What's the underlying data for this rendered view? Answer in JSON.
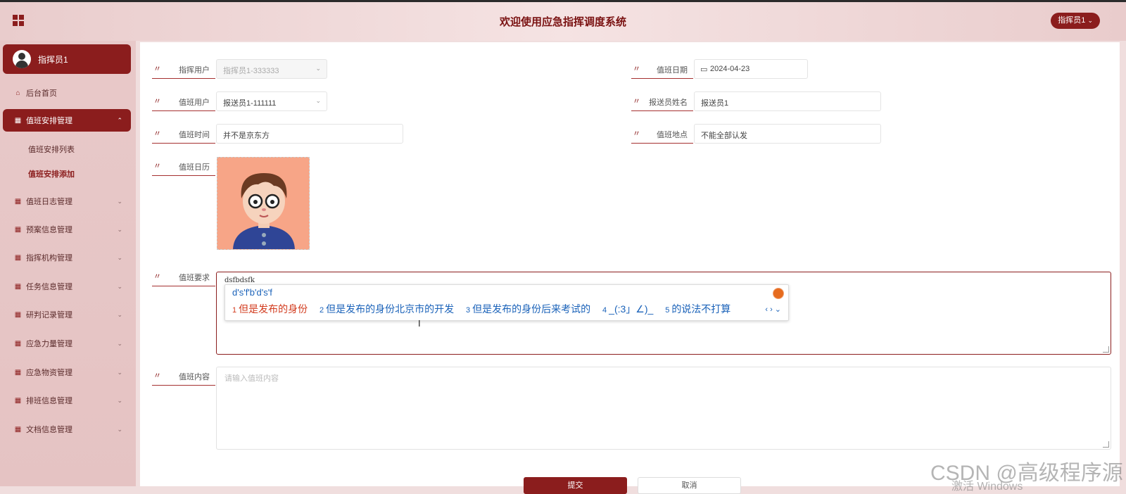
{
  "header": {
    "title": "欢迎使用应急指挥调度系统",
    "user_menu": "指挥员1"
  },
  "sidebar": {
    "profile_name": "指挥员1",
    "items": [
      {
        "label": "后台首页",
        "icon": "home-icon"
      },
      {
        "label": "值班安排管理",
        "icon": "grid-icon",
        "expanded": true
      },
      {
        "label": "值班日志管理",
        "icon": "grid-icon"
      },
      {
        "label": "预案信息管理",
        "icon": "grid-icon"
      },
      {
        "label": "指挥机构管理",
        "icon": "grid-icon"
      },
      {
        "label": "任务信息管理",
        "icon": "grid-icon"
      },
      {
        "label": "研判记录管理",
        "icon": "grid-icon"
      },
      {
        "label": "应急力量管理",
        "icon": "grid-icon"
      },
      {
        "label": "应急物资管理",
        "icon": "grid-icon"
      },
      {
        "label": "排班信息管理",
        "icon": "grid-icon"
      },
      {
        "label": "文档信息管理",
        "icon": "grid-icon"
      }
    ],
    "subitems": [
      {
        "label": "值班安排列表"
      },
      {
        "label": "值班安排添加"
      }
    ]
  },
  "form": {
    "commander_user": {
      "label": "指挥用户",
      "value": "指挥员1-333333"
    },
    "duty_date": {
      "label": "值班日期",
      "value": "2024-04-23"
    },
    "duty_user": {
      "label": "值班用户",
      "value": "报送员1-111111"
    },
    "reporter_name": {
      "label": "报送员姓名",
      "value": "报送员1"
    },
    "duty_time": {
      "label": "值班时间",
      "value": "并不是京东方"
    },
    "duty_place": {
      "label": "值班地点",
      "value": "不能全部认发"
    },
    "duty_calendar": {
      "label": "值班日历"
    },
    "duty_requirement": {
      "label": "值班要求",
      "value": "dsfbdsfk",
      "ime": {
        "input": "d's'f'b'd's'f",
        "candidates": [
          {
            "num": "1",
            "text": "但是发布的身份"
          },
          {
            "num": "2",
            "text": "但是发布的身份北京市的开发"
          },
          {
            "num": "3",
            "text": "但是发布的身份后来考试的"
          },
          {
            "num": "4",
            "text": "_(:3」∠)_"
          },
          {
            "num": "5",
            "text": "的说法不打算"
          }
        ],
        "nav": "‹ › ⌄"
      }
    },
    "duty_content": {
      "label": "值班内容",
      "placeholder": "请输入值班内容"
    },
    "submit_label": "提交",
    "cancel_label": "取消"
  },
  "overlay": {
    "watermark": "CSDN @高级程序源",
    "activate": "激活 Windows"
  },
  "colors": {
    "primary": "#8b1d1d",
    "sidebar_bg": "#e8c9c9",
    "ime_blue": "#1a62b9",
    "ime_selected": "#d23b1e"
  }
}
